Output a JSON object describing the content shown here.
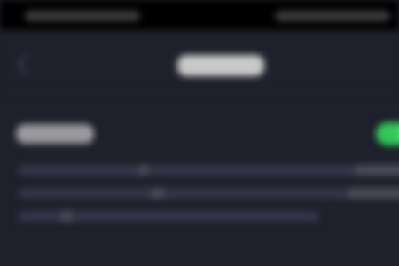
{
  "status_bar": {
    "left_text": "",
    "right_text": ""
  },
  "nav": {
    "back_icon": "chevron-left-icon",
    "title": ""
  },
  "setting": {
    "label": "",
    "toggle_on": true,
    "toggle_color": "#34c759",
    "description_lines": [
      "",
      "",
      ""
    ]
  },
  "colors": {
    "background": "#1e202b",
    "status_bar": "#000000",
    "accent": "#34c759"
  }
}
